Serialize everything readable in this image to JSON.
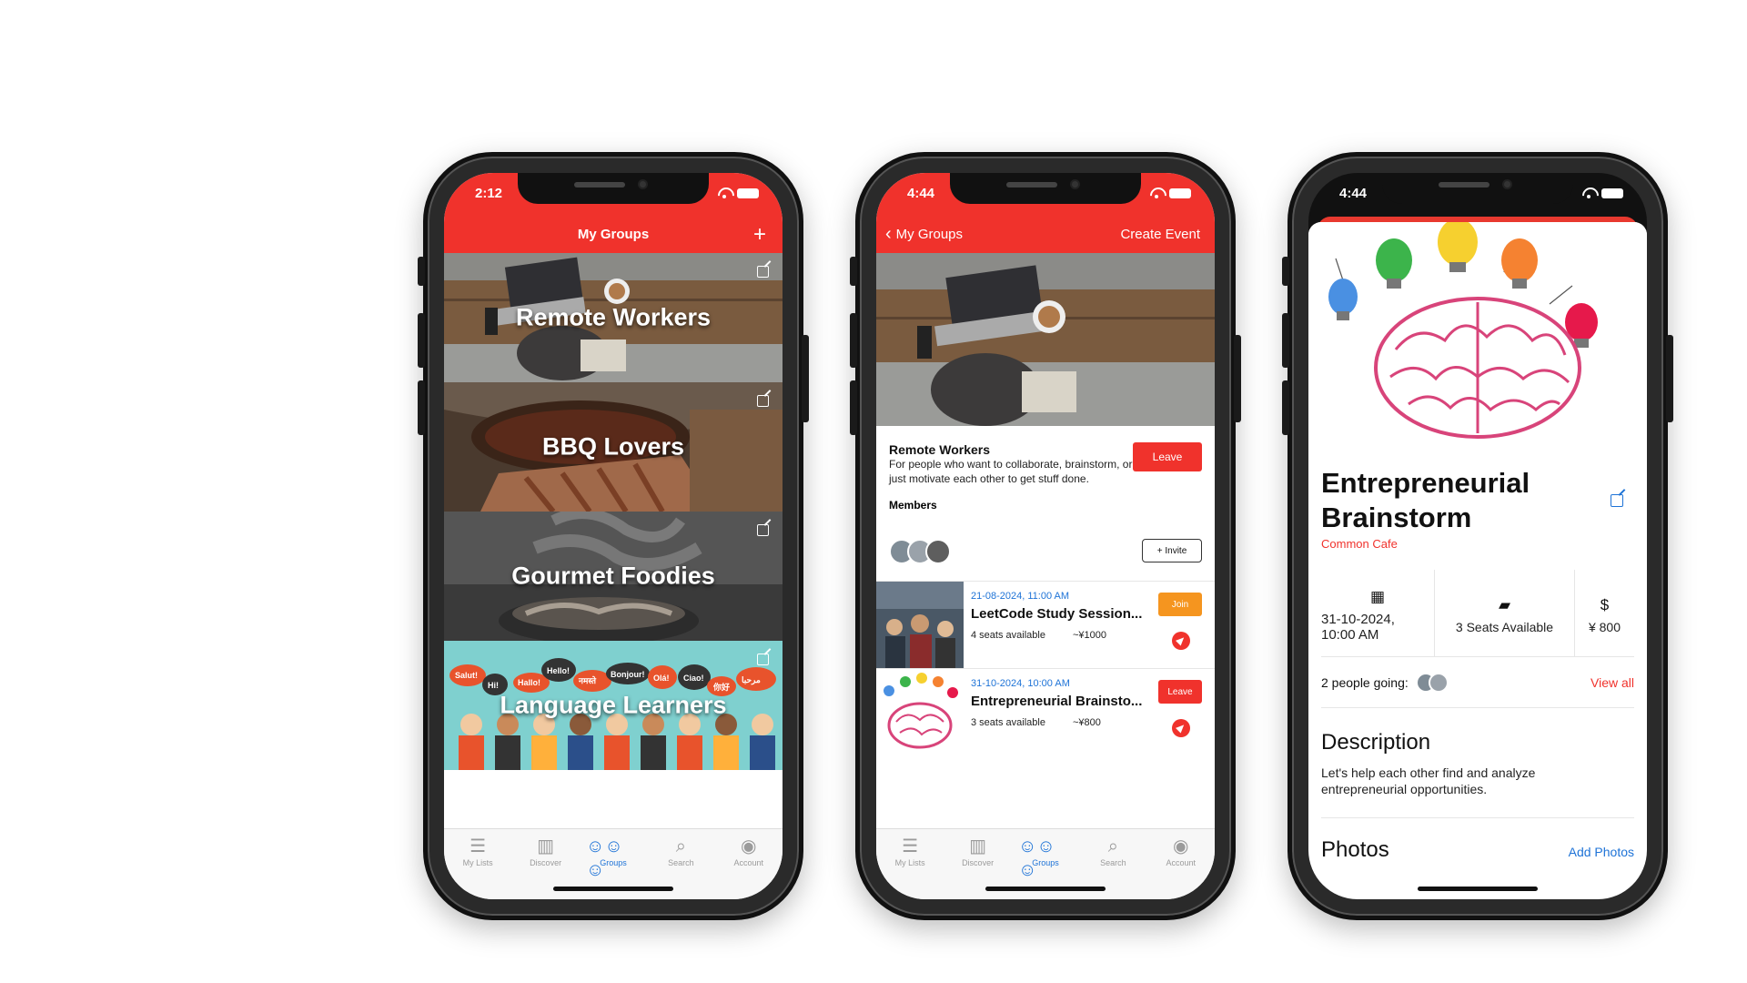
{
  "tabs": [
    {
      "label": "My Lists",
      "icon": "list-icon"
    },
    {
      "label": "Discover",
      "icon": "map-icon"
    },
    {
      "label": "Groups",
      "icon": "groups-icon"
    },
    {
      "label": "Search",
      "icon": "search-icon"
    },
    {
      "label": "Account",
      "icon": "account-icon"
    }
  ],
  "phone1": {
    "time": "2:12",
    "nav_title": "My Groups",
    "add_label": "+",
    "groups": [
      "Remote Workers",
      "BBQ Lovers",
      "Gourmet Foodies",
      "Language Learners"
    ],
    "language_bubbles": [
      "Salut!",
      "Hi!",
      "Hallo!",
      "Hello!",
      "नमस्ते",
      "Bonjour!",
      "Olá!",
      "Ciao!",
      "你好",
      "مرحبا"
    ]
  },
  "phone2": {
    "time": "4:44",
    "back_label": "My Groups",
    "right_action": "Create Event",
    "group_name": "Remote Workers",
    "group_desc": "For people who want to collaborate, brainstorm, or just motivate each other to get stuff done.",
    "members_label": "Members",
    "leave_label": "Leave",
    "invite_label": "+ Invite",
    "events": [
      {
        "date": "21-08-2024, 11:00 AM",
        "name": "LeetCode Study Session...",
        "seats": "4 seats available",
        "price": "~¥1000",
        "action": "Join"
      },
      {
        "date": "31-10-2024, 10:00 AM",
        "name": "Entrepreneurial Brainsto...",
        "seats": "3 seats available",
        "price": "~¥800",
        "action": "Leave"
      }
    ]
  },
  "phone3": {
    "time": "4:44",
    "title": "Entrepreneurial Brainstorm",
    "location": "Common Cafe",
    "datetime": "31-10-2024, 10:00 AM",
    "seats": "3 Seats Available",
    "price": "¥ 800",
    "going": "2 people going:",
    "view_all": "View all",
    "desc_heading": "Description",
    "desc_text": "Let's help each other find and analyze entrepreneurial opportunities.",
    "photos_heading": "Photos",
    "add_photos": "Add Photos"
  },
  "colors": {
    "accent": "#f0322c",
    "link": "#1e73d7",
    "join": "#f5951f"
  }
}
